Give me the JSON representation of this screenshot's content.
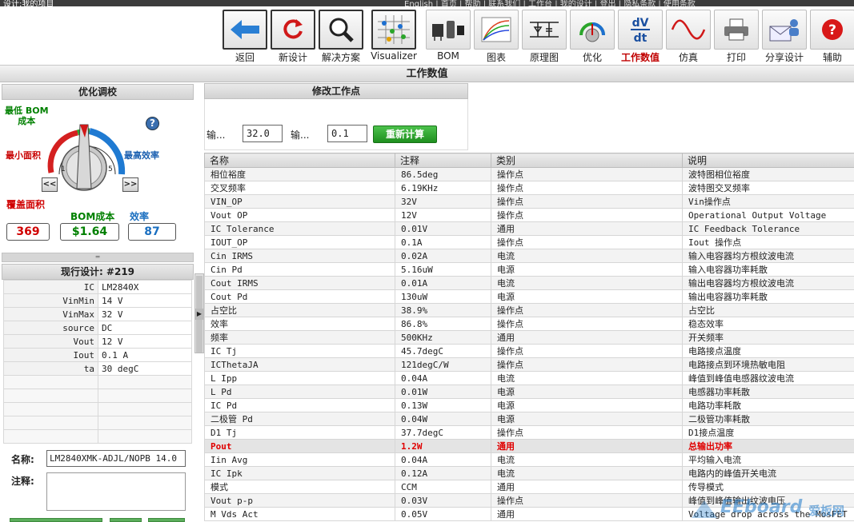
{
  "top_strip": {
    "title": "设计:我的项目",
    "menu": "English | 首页 | 帮助 | 联系我们 | 工作台 | 我的设计 | 登出 | 隐私条款 | 使用条款"
  },
  "toolbar": {
    "items": [
      {
        "label": "返回",
        "icon": "back-arrow-icon"
      },
      {
        "label": "新设计",
        "icon": "refresh-icon"
      },
      {
        "label": "解决方案",
        "icon": "magnifier-icon"
      },
      {
        "label": "Visualizer",
        "icon": "visualizer-grid-icon"
      },
      {
        "label": "BOM",
        "icon": "components-icon"
      },
      {
        "label": "图表",
        "icon": "chart-icon"
      },
      {
        "label": "原理图",
        "icon": "schematic-icon"
      },
      {
        "label": "优化",
        "icon": "dial-icon"
      },
      {
        "label": "工作数值",
        "icon": "dv-dt-icon"
      },
      {
        "label": "仿真",
        "icon": "sine-wave-icon"
      },
      {
        "label": "打印",
        "icon": "printer-icon"
      },
      {
        "label": "分享设计",
        "icon": "share-icon"
      },
      {
        "label": "辅助",
        "icon": "help-icon"
      }
    ],
    "active_label": "工作数值"
  },
  "page_title": "工作数值",
  "optimize": {
    "header": "优化调校",
    "label_low_bom": "最低 BOM\n成本",
    "label_min_area": "最小面积",
    "label_max_eff": "最高效率",
    "dial_min": "1",
    "dial_max": "5",
    "prev": "<<",
    "next": ">>",
    "metrics": [
      {
        "title": "覆盖面积",
        "value": "369",
        "color": "#d00000"
      },
      {
        "title": "BOM成本",
        "value": "$1.64",
        "color": "#008000"
      },
      {
        "title": "效率",
        "value": "87",
        "color": "#1a6fc0"
      }
    ]
  },
  "divider_grip": "═",
  "current_design": {
    "header": "现行设计: #219",
    "rows": [
      {
        "key": "IC",
        "value": "LM2840X"
      },
      {
        "key": "VinMin",
        "value": "14 V"
      },
      {
        "key": "VinMax",
        "value": "32 V"
      },
      {
        "key": "source",
        "value": "DC"
      },
      {
        "key": "Vout",
        "value": "12 V"
      },
      {
        "key": "Iout",
        "value": "0.1 A"
      },
      {
        "key": "ta",
        "value": "30 degC"
      }
    ]
  },
  "name_label": "名称:",
  "name_value": "LM2840XMK-ADJL/NOPB 14.0",
  "note_label": "注释:",
  "modify": {
    "header": "修改工作点",
    "input1_label": "输...",
    "input1_value": "32.0",
    "input2_label": "输...",
    "input2_value": "0.1",
    "recalc": "重新计算"
  },
  "table": {
    "headers": [
      "名称",
      "注释",
      "类别",
      "说明"
    ],
    "rows": [
      [
        "相位裕度",
        "86.5deg",
        "操作点",
        "波特图相位裕度"
      ],
      [
        "交叉频率",
        "6.19KHz",
        "操作点",
        "波特图交叉频率"
      ],
      [
        "VIN_OP",
        "32V",
        "操作点",
        "Vin操作点"
      ],
      [
        "Vout OP",
        "12V",
        "操作点",
        "Operational Output Voltage"
      ],
      [
        "IC Tolerance",
        "0.01V",
        "通用",
        "IC Feedback Tolerance"
      ],
      [
        "IOUT_OP",
        "0.1A",
        "操作点",
        "Iout 操作点"
      ],
      [
        "Cin IRMS",
        "0.02A",
        "电流",
        "输入电容器均方根纹波电流"
      ],
      [
        "Cin Pd",
        "5.16uW",
        "电源",
        "输入电容器功率耗散"
      ],
      [
        "Cout IRMS",
        "0.01A",
        "电流",
        "输出电容器均方根纹波电流"
      ],
      [
        "Cout Pd",
        "130uW",
        "电源",
        "输出电容器功率耗散"
      ],
      [
        "占空比",
        "38.9%",
        "操作点",
        "占空比"
      ],
      [
        "效率",
        "86.8%",
        "操作点",
        "稳态效率"
      ],
      [
        "频率",
        "500KHz",
        "通用",
        "开关频率"
      ],
      [
        "IC Tj",
        "45.7degC",
        "操作点",
        "电路接点温度"
      ],
      [
        "ICThetaJA",
        "121degC/W",
        "操作点",
        "电路接点到环境热敏电阻"
      ],
      [
        "L Ipp",
        "0.04A",
        "电流",
        "峰值到峰值电感器纹波电流"
      ],
      [
        "L Pd",
        "0.01W",
        "电源",
        "电感器功率耗散"
      ],
      [
        "IC Pd",
        "0.13W",
        "电源",
        "电路功率耗散"
      ],
      [
        "二极管 Pd",
        "0.04W",
        "电源",
        "二极管功率耗散"
      ],
      [
        "D1 Tj",
        "37.7degC",
        "操作点",
        "D1接点温度"
      ],
      [
        "Pout",
        "1.2W",
        "通用",
        "总输出功率"
      ],
      [
        "Iin Avg",
        "0.04A",
        "电流",
        "平均输入电流"
      ],
      [
        "IC Ipk",
        "0.12A",
        "电流",
        "电路内的峰值开关电流"
      ],
      [
        "模式",
        "CCM",
        "通用",
        "传导模式"
      ],
      [
        "Vout p-p",
        "0.03V",
        "操作点",
        "峰值到峰值输出纹波电压"
      ],
      [
        "M Vds Act",
        "0.05V",
        "通用",
        "Voltage drop across the MosFET"
      ]
    ],
    "highlight_row": 20
  },
  "watermark": {
    "text": "EEboard",
    "sub": "爱板网"
  }
}
